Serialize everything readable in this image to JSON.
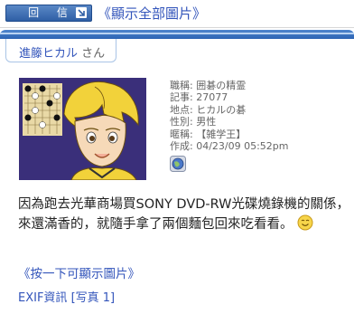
{
  "toolbar": {
    "reply_label": "回 信",
    "show_all_label": "《顯示全部圖片》"
  },
  "author": {
    "name": "進籐ヒカル",
    "suffix": " さん"
  },
  "profile": {
    "rows": [
      "職稱: 囲碁の精霊",
      "記事: 27077",
      "地点: ヒカルの碁",
      "性別: 男性",
      "暱稱: 【雑学王】",
      "作成: 04/23/09 05:52pm"
    ]
  },
  "post": {
    "line1": "因為跑去光華商場買SONY DVD-RW光碟燒錄機的關係，",
    "line2": "來還滿香的，就隨手拿了兩個麵包回來吃看看。"
  },
  "links": {
    "click_show": "《按一下可顯示圖片》",
    "exif": "EXIF資訊 [写真 1]"
  },
  "colors": {
    "accent_blue": "#2f5fa5",
    "link_blue": "#3355bb"
  },
  "icons": [
    "reply-arrow-icon",
    "globe-icon",
    "smiley-icon"
  ]
}
